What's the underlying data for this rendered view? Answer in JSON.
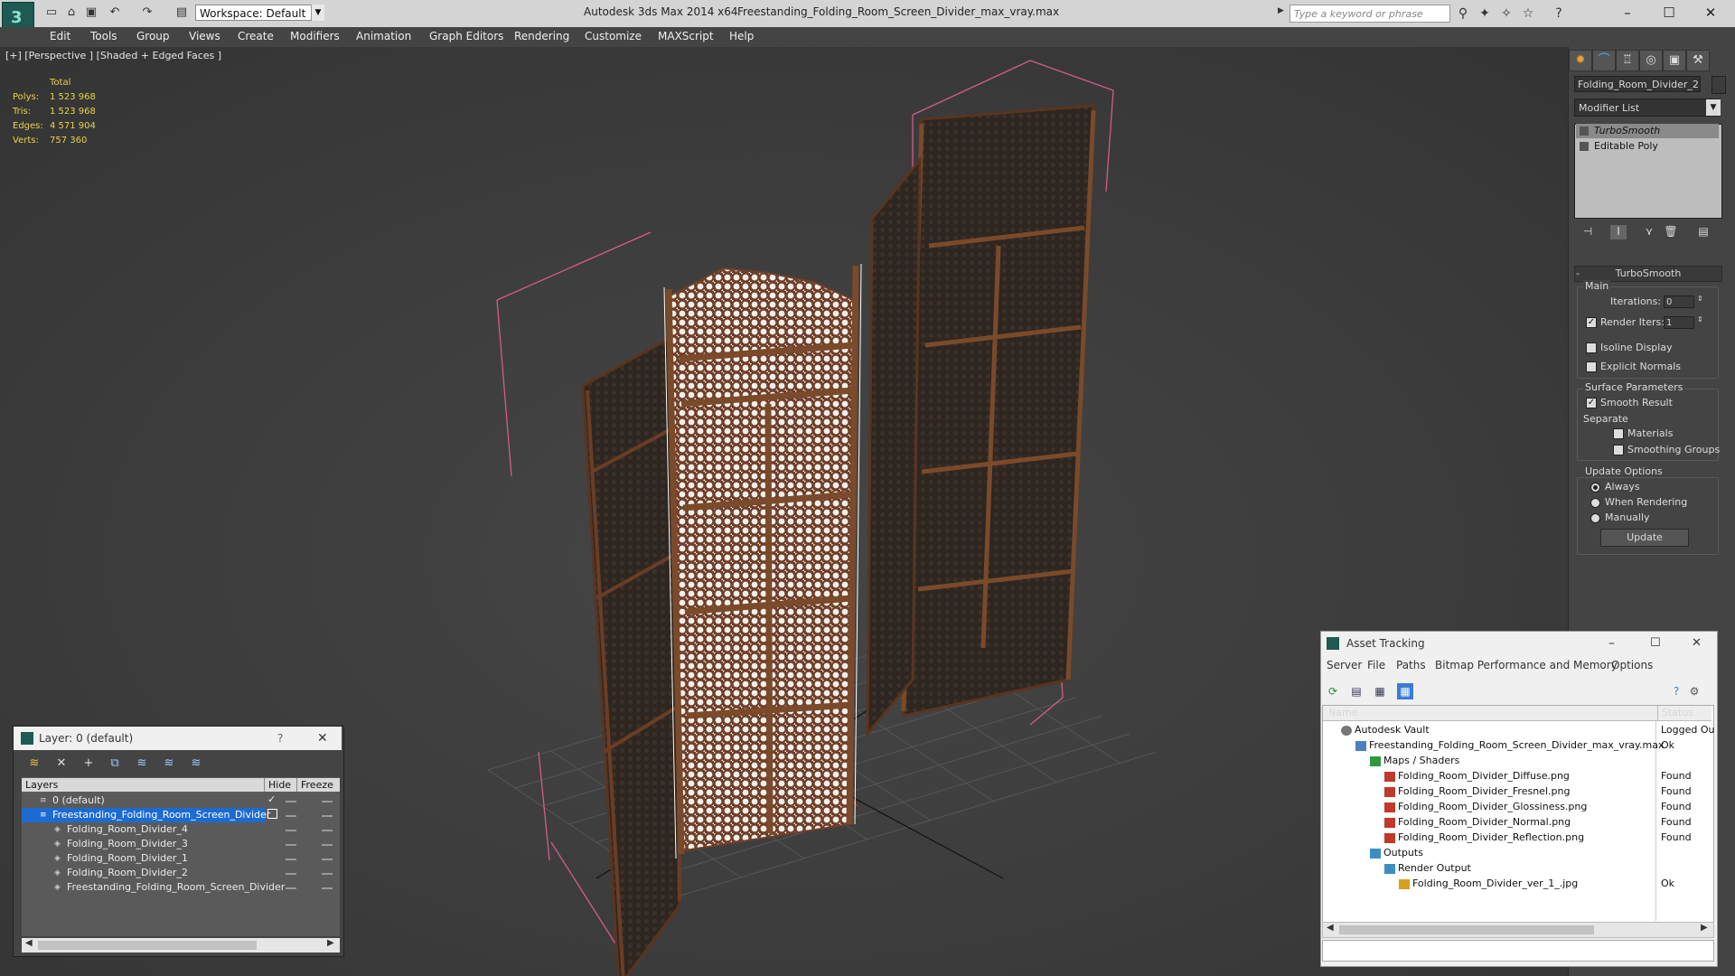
{
  "titlebar": {
    "workspace": "Workspace: Default",
    "app_title": "Autodesk 3ds Max  2014 x64",
    "file_title": "Freestanding_Folding_Room_Screen_Divider_max_vray.max",
    "search_placeholder": "Type a keyword or phrase"
  },
  "menu": [
    "Edit",
    "Tools",
    "Group",
    "Views",
    "Create",
    "Modifiers",
    "Animation",
    "Graph Editors",
    "Rendering",
    "Customize",
    "MAXScript",
    "Help"
  ],
  "viewport": {
    "label": "[+] [Perspective ] [Shaded + Edged Faces ]",
    "stats_title": "Total",
    "stats": [
      {
        "label": "Polys:",
        "value": "1 523 968"
      },
      {
        "label": "Tris:",
        "value": "1 523 968"
      },
      {
        "label": "Edges:",
        "value": "4 571 904"
      },
      {
        "label": "Verts:",
        "value": "757 360"
      }
    ]
  },
  "command_panel": {
    "object_name": "Folding_Room_Divider_2",
    "modifier_list": "Modifier List",
    "stack": [
      "TurboSmooth",
      "Editable Poly"
    ],
    "rollout_title": "TurboSmooth",
    "main_label": "Main",
    "iterations_label": "Iterations:",
    "iterations_value": "0",
    "render_iters_label": "Render Iters:",
    "render_iters_value": "1",
    "isoline": "Isoline Display",
    "explicit_normals": "Explicit Normals",
    "surface_params": "Surface Parameters",
    "smooth_result": "Smooth Result",
    "separate": "Separate",
    "materials": "Materials",
    "smoothing_groups": "Smoothing Groups",
    "update_options": "Update Options",
    "always": "Always",
    "when_rendering": "When Rendering",
    "manually": "Manually",
    "update_button": "Update"
  },
  "layers": {
    "title": "Layer: 0 (default)",
    "help": "?",
    "col_layers": "Layers",
    "col_hide": "Hide",
    "col_freeze": "Freeze",
    "rows": [
      "0 (default)",
      "Freestanding_Folding_Room_Screen_Divider",
      "Folding_Room_Divider_4",
      "Folding_Room_Divider_3",
      "Folding_Room_Divider_1",
      "Folding_Room_Divider_2",
      "Freestanding_Folding_Room_Screen_Divider"
    ]
  },
  "asset_tracking": {
    "title": "Asset Tracking",
    "menu": [
      "Server",
      "File",
      "Paths",
      "Bitmap Performance and Memory",
      "Options"
    ],
    "col_name": "Name",
    "col_status": "Status",
    "rows": [
      {
        "name": "Autodesk Vault",
        "status": "Logged Ou"
      },
      {
        "name": "Freestanding_Folding_Room_Screen_Divider_max_vray.max",
        "status": "Ok"
      },
      {
        "name": "Maps / Shaders",
        "status": ""
      },
      {
        "name": "Folding_Room_Divider_Diffuse.png",
        "status": "Found"
      },
      {
        "name": "Folding_Room_Divider_Fresnel.png",
        "status": "Found"
      },
      {
        "name": "Folding_Room_Divider_Glossiness.png",
        "status": "Found"
      },
      {
        "name": "Folding_Room_Divider_Normal.png",
        "status": "Found"
      },
      {
        "name": "Folding_Room_Divider_Reflection.png",
        "status": "Found"
      },
      {
        "name": "Outputs",
        "status": ""
      },
      {
        "name": "Render Output",
        "status": ""
      },
      {
        "name": "Folding_Room_Divider_ver_1_.jpg",
        "status": "Ok"
      }
    ]
  }
}
